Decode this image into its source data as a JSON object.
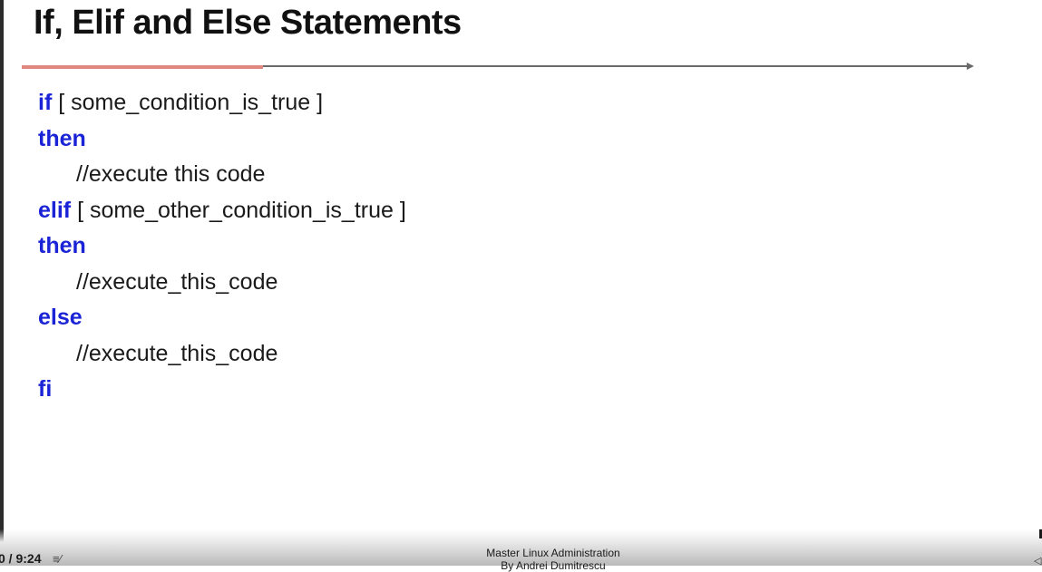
{
  "slide": {
    "title": "If, Elif and Else Statements",
    "keyword_color": "#1a23d6",
    "lines": [
      {
        "keyword": "if",
        "text": " [ some_condition_is_true ]"
      },
      {
        "keyword": "then",
        "text": ""
      },
      {
        "keyword": "",
        "text": "//execute this code"
      },
      {
        "keyword": "elif",
        "text": " [ some_other_condition_is_true ]"
      },
      {
        "keyword": "then",
        "text": ""
      },
      {
        "keyword": "",
        "text": "//execute_this_code"
      },
      {
        "keyword": "else",
        "text": ""
      },
      {
        "keyword": "",
        "text": "//execute_this_code"
      },
      {
        "keyword": "fi",
        "text": ""
      }
    ]
  },
  "player": {
    "time": "0 / 9:24",
    "playlist_icon": "playlist-icon",
    "course_title": "Master Linux Administration",
    "course_author": "By Andrei Dumitrescu"
  }
}
